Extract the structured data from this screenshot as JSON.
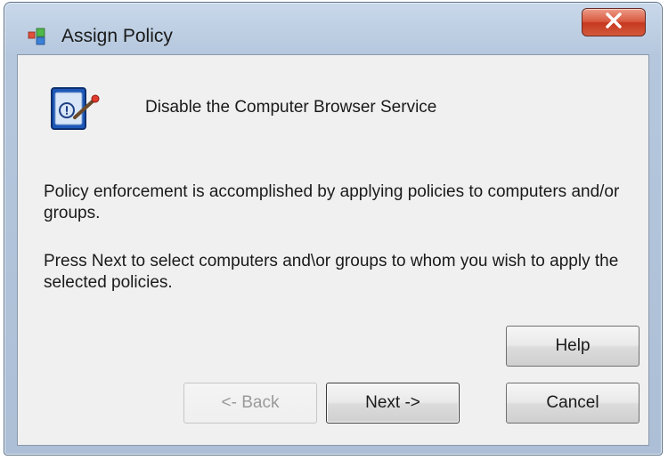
{
  "window": {
    "title": "Assign Policy"
  },
  "policy": {
    "name": "Disable the Computer Browser Service"
  },
  "messages": {
    "enforcement": "Policy enforcement is accomplished by applying policies to computers and/or groups.",
    "instructions": "Press Next to select computers and\\or groups to whom you wish to apply the selected policies."
  },
  "buttons": {
    "help": "Help",
    "back": "<- Back",
    "next": "Next ->",
    "cancel": "Cancel"
  },
  "icons": {
    "app": "policy-app-icon",
    "close": "close-icon",
    "policy": "policy-document-icon"
  },
  "colors": {
    "close_button": "#d9583f",
    "client_background": "#f0f0f0"
  }
}
